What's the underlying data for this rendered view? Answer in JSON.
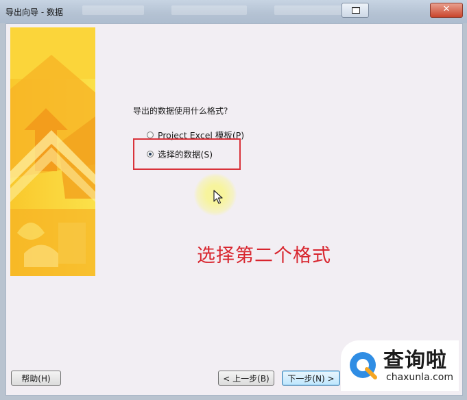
{
  "window": {
    "title": "导出向导 - 数据",
    "close_glyph": "✕"
  },
  "wizard": {
    "question": "导出的数据使用什么格式?",
    "options": [
      {
        "label": "Project Excel 模板(P)",
        "selected": false
      },
      {
        "label": "选择的数据(S)",
        "selected": true
      }
    ],
    "caption": "选择第二个格式",
    "buttons": {
      "help": "帮助(H)",
      "back": "< 上一步(B)",
      "next": "下一步(N) >"
    }
  },
  "watermark": {
    "name": "查询啦",
    "domain": "chaxunla.com"
  },
  "colors": {
    "highlight": "#d9323a",
    "caption": "#d8252e",
    "banner_orange": "#f5a81a",
    "banner_yellow": "#fcd535"
  }
}
